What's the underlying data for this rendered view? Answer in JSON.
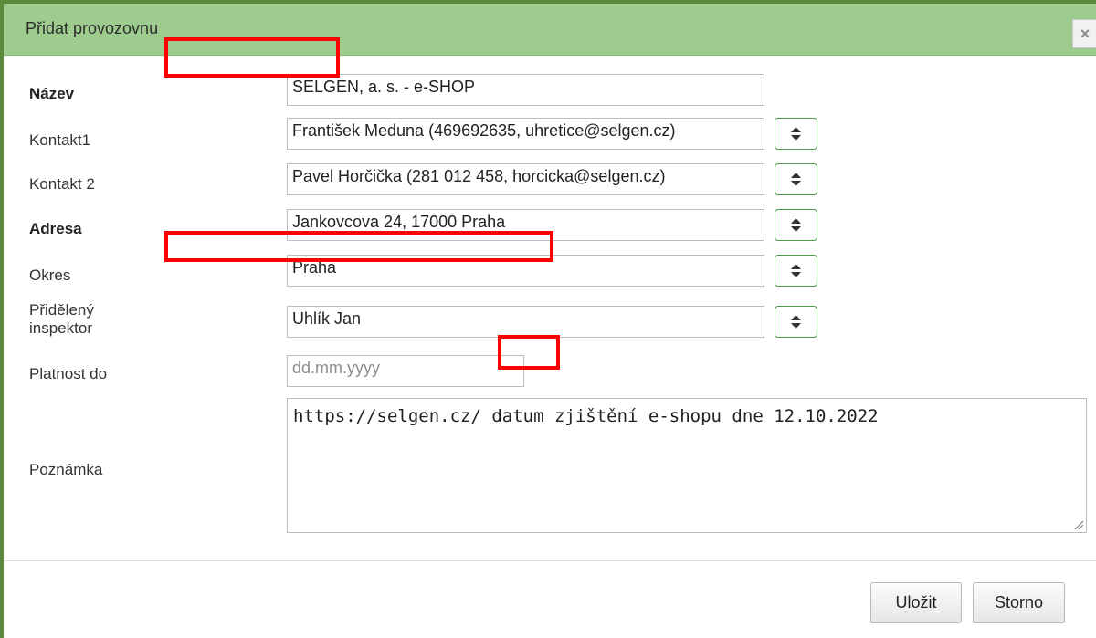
{
  "dialog": {
    "title": "Přidat provozovnu",
    "close_symbol": "×"
  },
  "form": {
    "nazev": {
      "label": "Název",
      "value": "SELGEN, a. s. - e-SHOP"
    },
    "kontakt1": {
      "label": "Kontakt1",
      "value": "František Meduna (469692635, uhretice@selgen.cz)"
    },
    "kontakt2": {
      "label": "Kontakt 2",
      "value": "Pavel Horčička (281 012 458, horcicka@selgen.cz)"
    },
    "adresa": {
      "label": "Adresa",
      "value": "Jankovcova 24, 17000 Praha"
    },
    "okres": {
      "label": "Okres",
      "value": "Praha"
    },
    "inspektor": {
      "label_line1": "Přidělený",
      "label_line2": "inspektor",
      "value": "Uhlík Jan"
    },
    "platnost": {
      "label": "Platnost do",
      "placeholder": "dd.mm.yyyy"
    },
    "poznamka": {
      "label": "Poznámka",
      "value": "https://selgen.cz/ datum zjištění e-shopu dne 12.10.2022"
    }
  },
  "buttons": {
    "save": "Uložit",
    "cancel": "Storno"
  },
  "colors": {
    "header": "#9dcc8e",
    "frame": "#5b8a3c",
    "spin_border": "#4c9a48",
    "highlight": "#ff0000"
  },
  "icons": {
    "spin": "sort-icon",
    "close": "close-icon",
    "resize": "resize-grip-icon"
  }
}
